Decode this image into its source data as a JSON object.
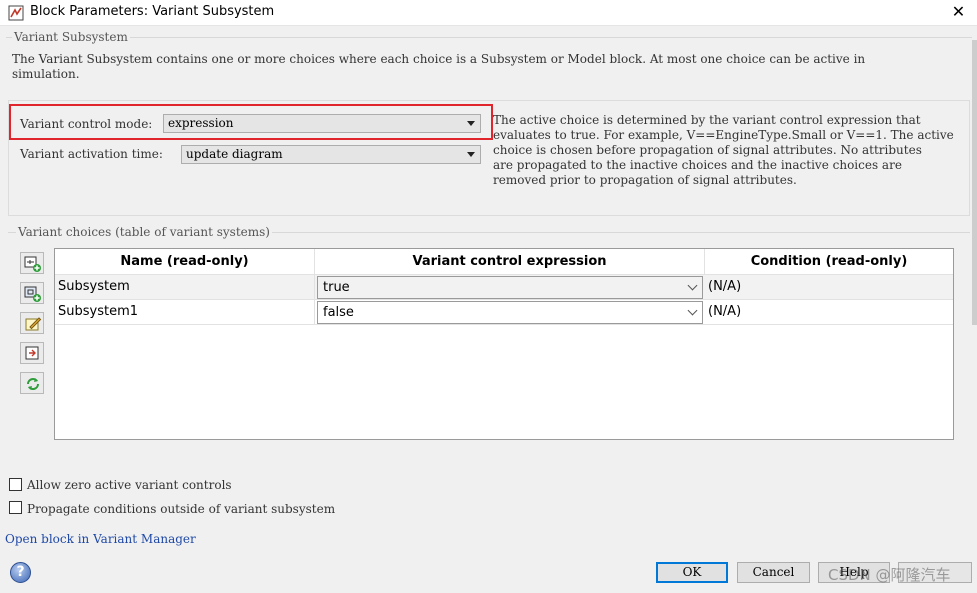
{
  "window": {
    "title": "Block Parameters: Variant Subsystem",
    "close_glyph": "✕"
  },
  "description": {
    "legend": "Variant Subsystem",
    "line1": "The Variant Subsystem contains one or more choices where each choice is a Subsystem or Model block. At most one choice can be active in",
    "line2": "simulation."
  },
  "params": {
    "control_mode_label": "Variant control mode:",
    "control_mode_value": "expression",
    "activation_label": "Variant activation time:",
    "activation_value": "update diagram",
    "help_lines": [
      "The active choice is determined by the variant control expression that",
      "evaluates to true. For example, V==EngineType.Small or V==1. The active",
      "choice is chosen before propagation of signal attributes. No attributes",
      "are propagated to the inactive choices and the inactive choices are",
      "removed prior to propagation of signal attributes."
    ]
  },
  "choices": {
    "legend": "Variant choices (table of variant systems)",
    "columns": [
      "Name (read-only)",
      "Variant control expression",
      "Condition (read-only)"
    ],
    "rows": [
      {
        "name": "Subsystem",
        "expression": "true",
        "condition": "(N/A)"
      },
      {
        "name": "Subsystem1",
        "expression": "false",
        "condition": "(N/A)"
      }
    ],
    "toolbar_icons": [
      "add-subsystem-choice-icon",
      "add-model-choice-icon",
      "edit-choice-icon",
      "open-choice-icon",
      "refresh-icon"
    ]
  },
  "options": {
    "allow_zero": {
      "label": "Allow zero active variant controls",
      "checked": false
    },
    "propagate": {
      "label": "Propagate conditions outside of variant subsystem",
      "checked": false
    }
  },
  "link": "Open block in Variant Manager",
  "buttons": {
    "ok": "OK",
    "cancel": "Cancel",
    "help": "Help"
  },
  "watermark": "CSDN @阿隆汽车",
  "colors": {
    "highlight_box": "#e0252c",
    "default_button_border": "#0078d7",
    "link": "#1f49a6"
  }
}
